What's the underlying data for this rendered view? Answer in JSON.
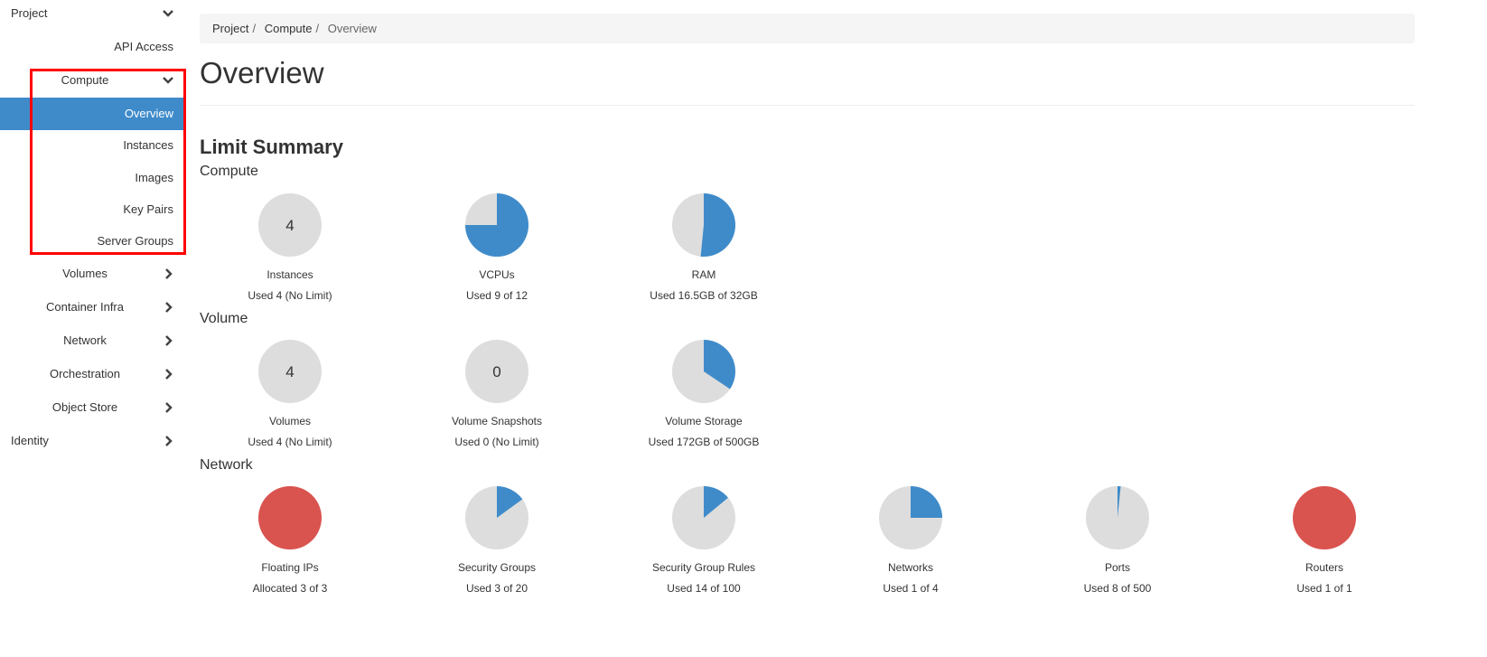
{
  "sidebar": {
    "project": "Project",
    "api_access": "API Access",
    "compute": "Compute",
    "overview": "Overview",
    "instances": "Instances",
    "images": "Images",
    "key_pairs": "Key Pairs",
    "server_groups": "Server Groups",
    "volumes": "Volumes",
    "container_infra": "Container Infra",
    "network": "Network",
    "orchestration": "Orchestration",
    "object_store": "Object Store",
    "identity": "Identity"
  },
  "breadcrumb": {
    "items": [
      "Project",
      "Compute"
    ],
    "current": "Overview"
  },
  "page_title": "Overview",
  "limit_summary": "Limit Summary",
  "colors": {
    "used": "#3f8bca",
    "free": "#dddddd",
    "full": "#d9534f",
    "active": "#3f8bca",
    "highlight_box": "#ff0000"
  },
  "sections": [
    {
      "title": "Compute",
      "charts": [
        {
          "label": "Instances",
          "text": "Used 4 (No Limit)",
          "used": 4,
          "limit": null,
          "center": "4"
        },
        {
          "label": "VCPUs",
          "text": "Used 9 of 12",
          "used": 9,
          "limit": 12
        },
        {
          "label": "RAM",
          "text": "Used 16.5GB of 32GB",
          "used": 16.5,
          "limit": 32
        }
      ]
    },
    {
      "title": "Volume",
      "charts": [
        {
          "label": "Volumes",
          "text": "Used 4 (No Limit)",
          "used": 4,
          "limit": null,
          "center": "4"
        },
        {
          "label": "Volume Snapshots",
          "text": "Used 0 (No Limit)",
          "used": 0,
          "limit": null,
          "center": "0"
        },
        {
          "label": "Volume Storage",
          "text": "Used 172GB of 500GB",
          "used": 172,
          "limit": 500
        }
      ]
    },
    {
      "title": "Network",
      "charts": [
        {
          "label": "Floating IPs",
          "text": "Allocated 3 of 3",
          "used": 3,
          "limit": 3
        },
        {
          "label": "Security Groups",
          "text": "Used 3 of 20",
          "used": 3,
          "limit": 20
        },
        {
          "label": "Security Group Rules",
          "text": "Used 14 of 100",
          "used": 14,
          "limit": 100
        },
        {
          "label": "Networks",
          "text": "Used 1 of 4",
          "used": 1,
          "limit": 4
        },
        {
          "label": "Ports",
          "text": "Used 8 of 500",
          "used": 8,
          "limit": 500
        },
        {
          "label": "Routers",
          "text": "Used 1 of 1",
          "used": 1,
          "limit": 1
        }
      ]
    }
  ]
}
